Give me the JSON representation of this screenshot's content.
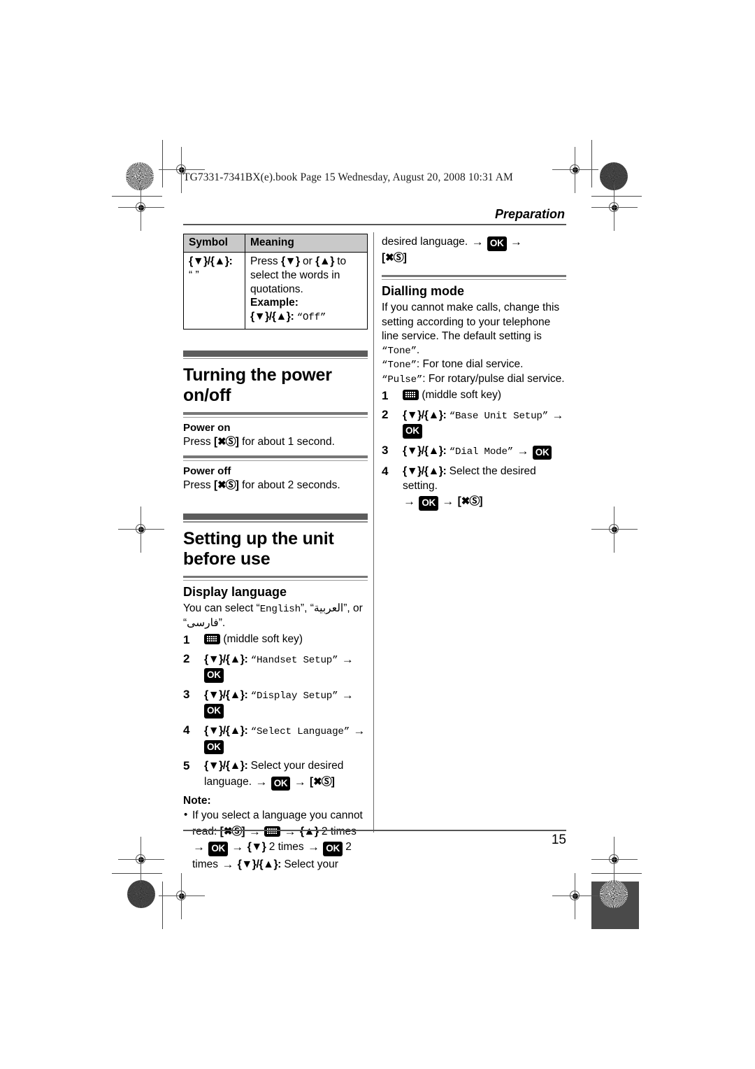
{
  "document": {
    "book_line": "TG7331-7341BX(e).book  Page 15  Wednesday, August 20, 2008  10:31 AM",
    "section_header": "Preparation",
    "page_number": "15"
  },
  "symbol_table": {
    "headers": [
      "Symbol",
      "Meaning"
    ],
    "rows": [
      {
        "symbol_keys": "{▼}/{▲}:",
        "symbol_quotes": "“ ”",
        "meaning_line1_a": "Press ",
        "meaning_line1_key1": "{▼}",
        "meaning_line1_b": " or ",
        "meaning_line1_key2": "{▲}",
        "meaning_line1_c": " to select the words in quotations.",
        "meaning_example_label": "Example:",
        "meaning_example_keys": "{▼}/{▲}:",
        "meaning_example_value": "“Off”"
      }
    ]
  },
  "left_column": {
    "power_section": {
      "title": "Turning the power on/off",
      "power_on": {
        "heading": "Power on",
        "text_before": "Press ",
        "key": "{✂◎}",
        "text_after": " for about 1 second."
      },
      "power_off": {
        "heading": "Power off",
        "text_before": "Press ",
        "key": "{✂◎}",
        "text_after": " for about 2 seconds."
      }
    },
    "setup_section": {
      "title": "Setting up the unit before use",
      "display_language": {
        "heading": "Display language",
        "intro_a": "You can select “",
        "intro_english": "English",
        "intro_b": "”, “",
        "intro_arabic": "العربية",
        "intro_c": "”, or “",
        "intro_persian": "فارسی",
        "intro_d": "”.",
        "steps": [
          {
            "num": "1",
            "icon": "soft-key-icon",
            "text": "(middle soft key)"
          },
          {
            "num": "2",
            "keys": "{▼}/{▲}:",
            "quote": "“Handset Setup”",
            "arrow": "→",
            "then": "OK"
          },
          {
            "num": "3",
            "keys": "{▼}/{▲}:",
            "quote": "“Display Setup”",
            "arrow": "→",
            "then": "OK"
          },
          {
            "num": "4",
            "keys": "{▼}/{▲}:",
            "quote": "“Select Language”",
            "arrow": "→",
            "then": "OK"
          },
          {
            "num": "5",
            "keys": "{▼}/{▲}:",
            "text": "Select your desired language.",
            "arrow": "→",
            "then": "OK",
            "arrow2": "→",
            "end_key": "{✂◎}"
          }
        ],
        "note_label": "Note:",
        "note_bullet": "•",
        "note_text_a": "If you select a language you cannot read: ",
        "note_key1": "{✂◎}",
        "note_arrow1": "→",
        "note_icon": "soft-key-icon",
        "note_arrow2": "→",
        "note_key2": "{▲}",
        "note_text_b": " 2 times ",
        "note_arrow3": "→",
        "note_ok1": "OK",
        "note_arrow4": "→",
        "note_key3": "{▼}",
        "note_text_c": " 2 times ",
        "note_arrow5": "→",
        "note_ok2": "OK",
        "note_text_d": " 2 times ",
        "note_arrow6": "→",
        "note_key4": "{▼}/{▲}:",
        "note_text_e": " Select your"
      }
    }
  },
  "right_column": {
    "continuation": {
      "text": "desired language.",
      "arrow1": "→",
      "ok": "OK",
      "arrow2": "→",
      "end_key": "{✂◎}"
    },
    "dialling_mode": {
      "heading": "Dialling mode",
      "intro": "If you cannot make calls, change this setting according to your telephone line service. The default setting is ",
      "intro_default_quote": "“Tone”",
      "intro_period": ".",
      "tone_line_quote": "“Tone”",
      "tone_line_rest": ": For tone dial service.",
      "pulse_line_quote": "“Pulse”",
      "pulse_line_rest": ": For rotary/pulse dial service.",
      "steps": [
        {
          "num": "1",
          "icon": "soft-key-icon",
          "text": "(middle soft key)"
        },
        {
          "num": "2",
          "keys": "{▼}/{▲}:",
          "quote": "“Base Unit Setup”",
          "arrow": "→",
          "then": "OK"
        },
        {
          "num": "3",
          "keys": "{▼}/{▲}:",
          "quote": "“Dial Mode”",
          "arrow": "→",
          "then": "OK"
        },
        {
          "num": "4",
          "keys": "{▼}/{▲}:",
          "text": "Select the desired setting.",
          "arrow": "→",
          "then": "OK",
          "arrow2": "→",
          "end_key": "{✂◎}"
        }
      ]
    }
  },
  "colors": {
    "table_header_bg": "#c9c9c9",
    "section_bar": "#5c5c5c",
    "rule": "#555555"
  }
}
